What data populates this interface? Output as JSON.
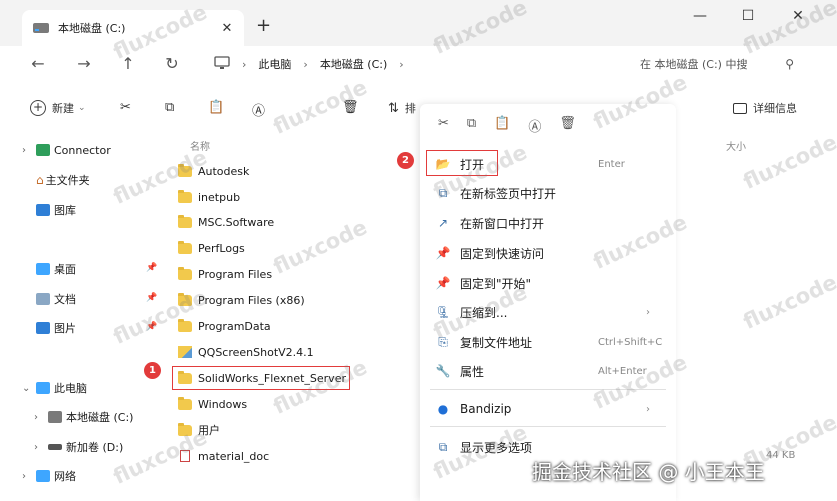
{
  "window": {
    "tab_title": "本地磁盘 (C:)",
    "close": "✕",
    "new_tab": "+",
    "min": "—",
    "max": "☐",
    "win_close": "✕"
  },
  "nav": {
    "back": "←",
    "forward": "→",
    "up": "↑",
    "refresh": "↻",
    "crumbs": [
      "此电脑",
      "本地磁盘 (C:)"
    ],
    "search_placeholder": "在 本地磁盘 (C:) 中搜"
  },
  "toolbar": {
    "new_label": "新建",
    "sort_label": "排",
    "details_label": "详细信息"
  },
  "sidebar": {
    "items": [
      {
        "label": "Connector"
      },
      {
        "label": "主文件夹"
      },
      {
        "label": "图库"
      },
      {
        "label": "桌面"
      },
      {
        "label": "文档"
      },
      {
        "label": "图片"
      },
      {
        "label": "此电脑"
      },
      {
        "label": "本地磁盘 (C:)"
      },
      {
        "label": "新加卷 (D:)"
      },
      {
        "label": "网络"
      }
    ]
  },
  "files": {
    "col_name": "名称",
    "col_size": "大小",
    "rows": [
      {
        "name": "Autodesk"
      },
      {
        "name": "inetpub"
      },
      {
        "name": "MSC.Software"
      },
      {
        "name": "PerfLogs"
      },
      {
        "name": "Program Files"
      },
      {
        "name": "Program Files (x86)"
      },
      {
        "name": "ProgramData"
      },
      {
        "name": "QQScreenShotV2.4.1"
      },
      {
        "name": "SolidWorks_Flexnet_Server"
      },
      {
        "name": "Windows"
      },
      {
        "name": "用户"
      },
      {
        "name": "material_doc"
      }
    ],
    "size_value": "44 KB"
  },
  "badges": {
    "one": "1",
    "two": "2"
  },
  "context_menu": {
    "items": [
      {
        "label": "打开",
        "shortcut": "Enter"
      },
      {
        "label": "在新标签页中打开"
      },
      {
        "label": "在新窗口中打开"
      },
      {
        "label": "固定到快速访问"
      },
      {
        "label": "固定到\"开始\""
      },
      {
        "label": "压缩到..."
      },
      {
        "label": "复制文件地址",
        "shortcut": "Ctrl+Shift+C"
      },
      {
        "label": "属性",
        "shortcut": "Alt+Enter"
      },
      {
        "label": "Bandizip"
      },
      {
        "label": "显示更多选项"
      }
    ]
  },
  "watermark_text": "fluxcode",
  "attribution": "掘金技术社区 @ 小王本王",
  "colors": {
    "highlight": "#e23b3b",
    "folder": "#f2c94c"
  }
}
